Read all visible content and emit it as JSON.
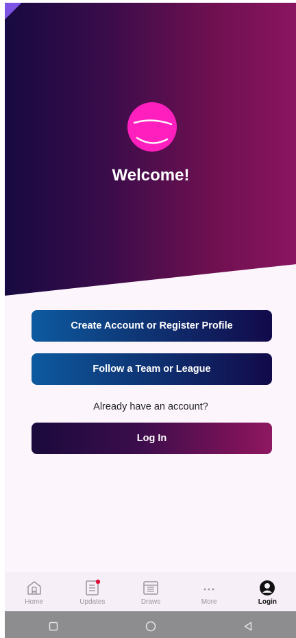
{
  "hero": {
    "welcome": "Welcome!"
  },
  "actions": {
    "create_account": "Create Account or Register Profile",
    "follow_team": "Follow a Team or League",
    "already_prompt": "Already have an account?",
    "log_in": "Log In"
  },
  "nav": {
    "items": [
      {
        "label": "Home",
        "icon": "home-icon",
        "active": false
      },
      {
        "label": "Updates",
        "icon": "updates-icon",
        "active": false,
        "badge": true
      },
      {
        "label": "Draws",
        "icon": "draws-icon",
        "active": false
      },
      {
        "label": "More",
        "icon": "more-icon",
        "active": false
      },
      {
        "label": "Login",
        "icon": "account-icon",
        "active": true
      }
    ]
  },
  "system_nav": {
    "buttons": [
      "recent-apps-icon",
      "home-circle-icon",
      "back-triangle-icon"
    ]
  },
  "colors": {
    "logo": "#ff1fbf",
    "hero_start": "#180a42",
    "hero_end": "#8a1560",
    "badge": "#e0103a"
  }
}
